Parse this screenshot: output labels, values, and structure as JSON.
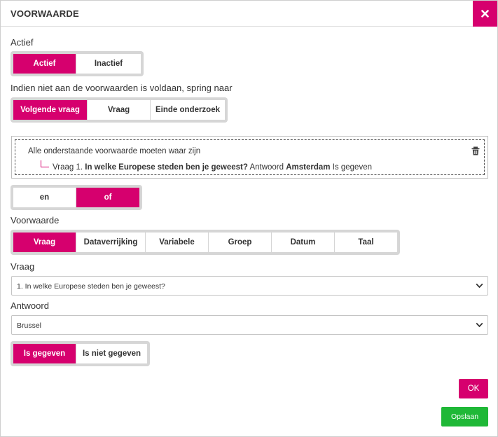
{
  "header": {
    "title": "VOORWAARDE",
    "close_icon": "close-icon"
  },
  "status": {
    "label": "Actief",
    "options": [
      "Actief",
      "Inactief"
    ],
    "selected": "Actief"
  },
  "jump": {
    "label": "Indien niet aan de voorwaarden is voldaan, spring naar",
    "options": [
      "Volgende vraag",
      "Vraag",
      "Einde onderzoek"
    ],
    "selected": "Volgende vraag"
  },
  "condition_box": {
    "heading": "Alle onderstaande voorwaarde moeten waar zijn",
    "item": {
      "prefix": "Vraag 1.",
      "question": "In welke Europese steden ben je geweest?",
      "answer_label": "Antwoord",
      "answer": "Amsterdam",
      "suffix": "Is gegeven"
    },
    "delete_icon": "trash-icon"
  },
  "logic": {
    "options": [
      "en",
      "of"
    ],
    "selected": "of"
  },
  "type": {
    "label": "Voorwaarde",
    "options": [
      "Vraag",
      "Dataverrijking",
      "Variabele",
      "Groep",
      "Datum",
      "Taal"
    ],
    "selected": "Vraag"
  },
  "question_select": {
    "label": "Vraag",
    "value": "1. In welke Europese steden ben je geweest?"
  },
  "answer_select": {
    "label": "Antwoord",
    "value": "Brussel"
  },
  "given": {
    "options": [
      "Is gegeven",
      "Is niet gegeven"
    ],
    "selected": "Is gegeven"
  },
  "buttons": {
    "ok": "OK",
    "save": "Opslaan"
  },
  "colors": {
    "accent": "#d6006e",
    "save": "#1fb837",
    "segment_track": "#d6d6d6"
  }
}
